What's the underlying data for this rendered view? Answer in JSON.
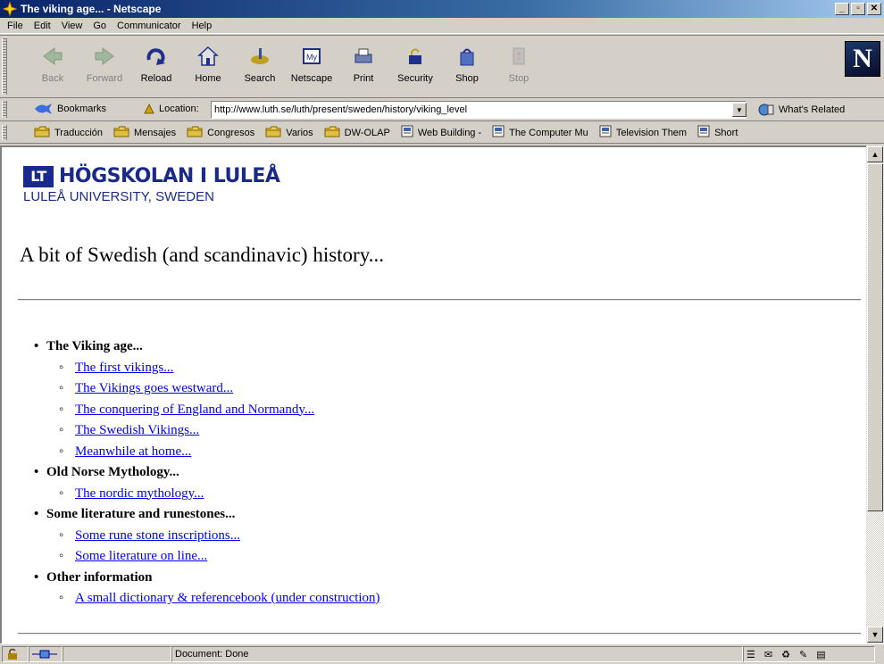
{
  "window": {
    "title": "The viking age... - Netscape"
  },
  "menu": [
    "File",
    "Edit",
    "View",
    "Go",
    "Communicator",
    "Help"
  ],
  "toolbar": {
    "buttons": [
      {
        "label": "Back",
        "icon": "back-arrow-icon",
        "disabled": true
      },
      {
        "label": "Forward",
        "icon": "forward-arrow-icon",
        "disabled": true
      },
      {
        "label": "Reload",
        "icon": "reload-icon",
        "disabled": false
      },
      {
        "label": "Home",
        "icon": "home-icon",
        "disabled": false
      },
      {
        "label": "Search",
        "icon": "search-icon",
        "disabled": false
      },
      {
        "label": "Netscape",
        "icon": "netscape-icon",
        "disabled": false
      },
      {
        "label": "Print",
        "icon": "print-icon",
        "disabled": false
      },
      {
        "label": "Security",
        "icon": "security-icon",
        "disabled": false
      },
      {
        "label": "Shop",
        "icon": "shop-icon",
        "disabled": false
      },
      {
        "label": "Stop",
        "icon": "stop-icon",
        "disabled": true
      }
    ],
    "logo": "N"
  },
  "location": {
    "bookmarks_label": "Bookmarks",
    "location_label": "Location:",
    "url": "http://www.luth.se/luth/present/sweden/history/viking_level",
    "related_label": "What's Related"
  },
  "personal_bar": [
    {
      "label": "Traducción",
      "icon": "folder-icon"
    },
    {
      "label": "Mensajes",
      "icon": "folder-icon"
    },
    {
      "label": "Congresos",
      "icon": "folder-icon"
    },
    {
      "label": "Varios",
      "icon": "folder-icon"
    },
    {
      "label": "DW-OLAP",
      "icon": "folder-icon"
    },
    {
      "label": "Web Building -",
      "icon": "bookmark-page-icon"
    },
    {
      "label": "The Computer Mu",
      "icon": "bookmark-page-icon"
    },
    {
      "label": "Television Them",
      "icon": "bookmark-page-icon"
    },
    {
      "label": "Short",
      "icon": "bookmark-page-icon"
    }
  ],
  "page": {
    "logo_main": "HÖGSKOLAN I LULEÅ",
    "logo_mark": "LT",
    "logo_sub": "LULEÅ UNIVERSITY, SWEDEN",
    "title": "A bit of Swedish (and scandinavic) history...",
    "sections": [
      {
        "title": "The Viking age...",
        "links": [
          "The first vikings...",
          "The Vikings goes westward...",
          "The conquering of England and Normandy...",
          "The Swedish Vikings...",
          "Meanwhile at home..."
        ]
      },
      {
        "title": "Old Norse Mythology...",
        "links": [
          "The nordic mythology..."
        ]
      },
      {
        "title": "Some literature and runestones...",
        "links": [
          "Some rune stone inscriptions...",
          "Some literature on line..."
        ]
      },
      {
        "title": "Other information",
        "links": [
          "A small dictionary & referencebook (under construction)"
        ]
      }
    ]
  },
  "status": {
    "text": "Document: Done"
  }
}
